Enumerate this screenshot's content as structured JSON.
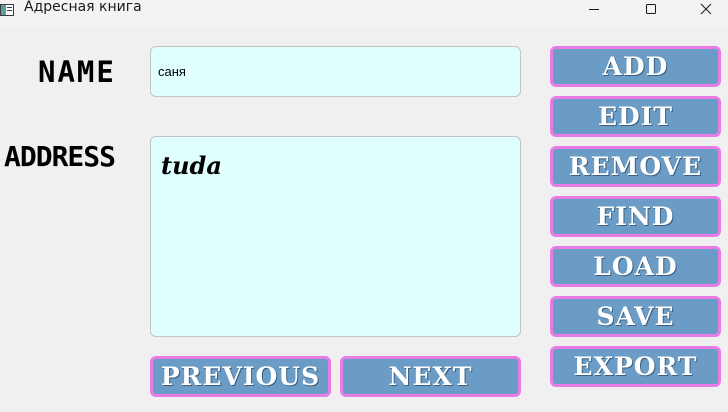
{
  "window": {
    "title": "Адресная книга",
    "icons": {
      "app": "address-book-icon",
      "minimize": "minimize-icon",
      "maximize": "maximize-icon",
      "close": "close-icon"
    }
  },
  "form": {
    "name_label": "NAME",
    "address_label": "ADDRESS",
    "name_value": "саня",
    "address_value": "tuda"
  },
  "buttons": {
    "add": "ADD",
    "edit": "EDIT",
    "remove": "REMOVE",
    "find": "FIND",
    "load": "LOAD",
    "save": "SAVE",
    "export": "EXPORT",
    "previous": "PREVIOUS",
    "next": "NEXT"
  },
  "colors": {
    "input_background": "#dfffff",
    "button_fill": "#6a9cc6",
    "button_border": "#e87be6",
    "window_background": "#f0f0f0"
  }
}
